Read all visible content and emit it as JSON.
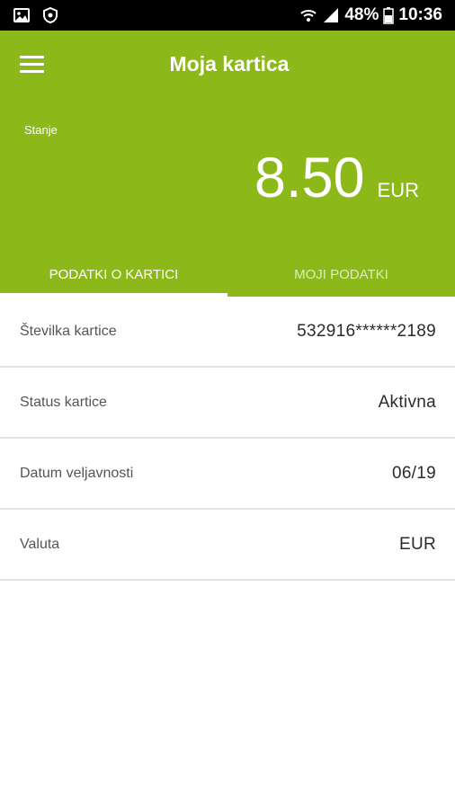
{
  "status_bar": {
    "battery": "48%",
    "time": "10:36",
    "icons": [
      "image-icon",
      "shield-icon",
      "wifi-icon",
      "signal-icon",
      "battery-icon"
    ]
  },
  "header": {
    "title": "Moja kartica",
    "balance_label": "Stanje",
    "balance_value": "8.50",
    "balance_currency": "EUR",
    "background_color": "#8cb81a"
  },
  "tabs": [
    {
      "label": "PODATKI O KARTICI",
      "active": true
    },
    {
      "label": "MOJI PODATKI",
      "active": false
    }
  ],
  "card_details": [
    {
      "label": "Številka kartice",
      "value": "532916******2189"
    },
    {
      "label": "Status kartice",
      "value": "Aktivna"
    },
    {
      "label": "Datum veljavnosti",
      "value": "06/19"
    },
    {
      "label": "Valuta",
      "value": "EUR"
    }
  ]
}
